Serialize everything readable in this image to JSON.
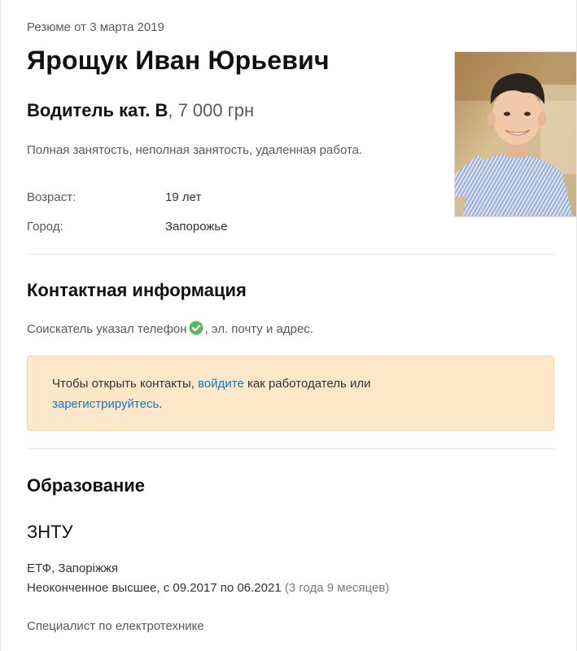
{
  "resume": {
    "date_text": "Резюме от 3 марта 2019",
    "full_name": "Ярощук Иван Юрьевич",
    "position": "Водитель кат. В",
    "salary": ", 7 000 грн",
    "employment": "Полная занятость, неполная занятость, удаленная работа.",
    "info": {
      "age_label": "Возраст:",
      "age_value": "19 лет",
      "city_label": "Город:",
      "city_value": "Запорожье"
    }
  },
  "contacts": {
    "heading": "Контактная информация",
    "note_before": "Соискатель указал телефон",
    "note_after": ", эл. почту и адрес.",
    "check_icon": "check-circle-icon",
    "check_color": "#5cb85c",
    "notice": {
      "text_1": "Чтобы открыть контакты, ",
      "login_link": "войдите",
      "text_2": " как работодатель или ",
      "register_link": "зарегистрируйтесь",
      "text_3": "."
    }
  },
  "education": {
    "heading": "Образование",
    "institution": "ЗНТУ",
    "faculty": "ЕТФ, Запоріжжя",
    "degree": "Неоконченное высшее, с 09.2017 по 06.2021",
    "duration": "(3 года 9 месяцев)",
    "specialty": "Специалист по електротехнике"
  },
  "colors": {
    "link": "#1677c4",
    "notice_bg": "#fde7c9",
    "notice_border": "#f4d2a2"
  }
}
